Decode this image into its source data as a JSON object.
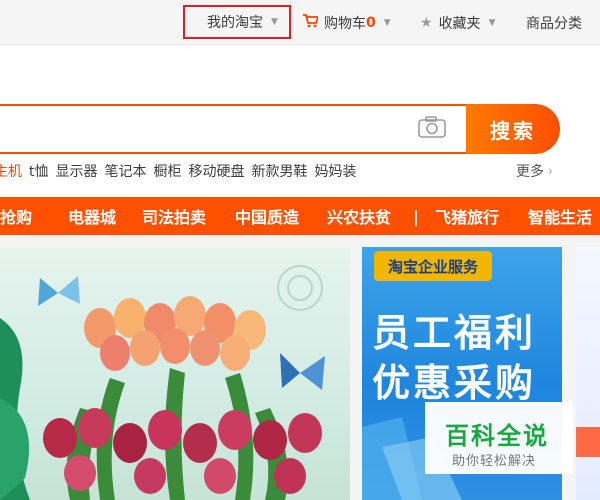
{
  "topbar": {
    "my_taobao": "我的淘宝",
    "cart_label": "购物车",
    "cart_count": "0",
    "favorites": "收藏夹",
    "categories": "商品分类"
  },
  "search": {
    "button_label": "搜索"
  },
  "hotwords": [
    "游戏主机",
    "t恤",
    "显示器",
    "笔记本",
    "橱柜",
    "移动硬盘",
    "新款男鞋",
    "妈妈装"
  ],
  "hotwords_visible": [
    "主机",
    "t恤",
    "显示器",
    "笔记本",
    "橱柜",
    "移动硬盘",
    "新款男鞋",
    "妈妈装"
  ],
  "more_label": "更多",
  "nav": [
    "淘抢购",
    "电器城",
    "司法拍卖",
    "中国质造",
    "兴农扶贫",
    "|",
    "飞猪旅行",
    "智能生活"
  ],
  "promo": {
    "tag": "淘宝企业服务",
    "line1": "员工福利",
    "line2": "优惠采购"
  },
  "watermark": {
    "title": "百科全说",
    "subtitle": "助你轻松解决"
  },
  "colors": {
    "brand_orange": "#ff5000",
    "highlight_red": "#e02020",
    "promo_blue": "#1f86de",
    "watermark_green": "#19a83f"
  }
}
